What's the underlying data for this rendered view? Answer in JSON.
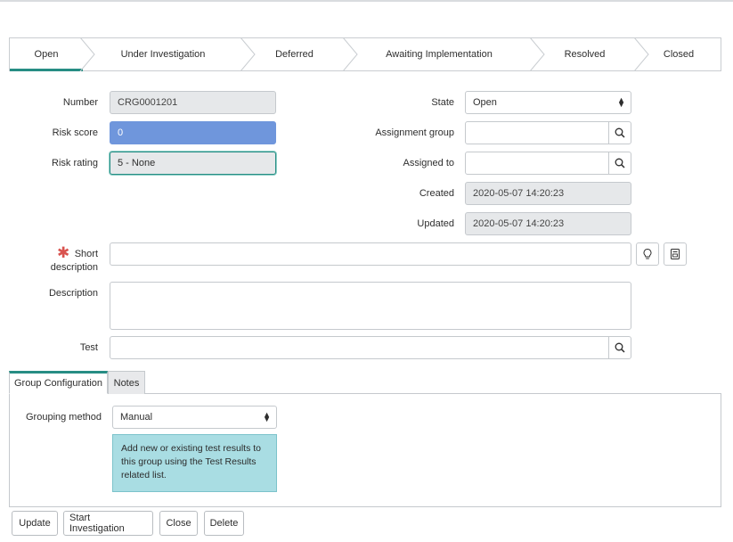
{
  "process_flow": {
    "steps": [
      {
        "label": "Open",
        "active": true
      },
      {
        "label": "Under Investigation",
        "active": false
      },
      {
        "label": "Deferred",
        "active": false
      },
      {
        "label": "Awaiting Implementation",
        "active": false
      },
      {
        "label": "Resolved",
        "active": false
      },
      {
        "label": "Closed",
        "active": false
      }
    ]
  },
  "form": {
    "number": {
      "label": "Number",
      "value": "CRG0001201"
    },
    "risk_score": {
      "label": "Risk score",
      "value": "0"
    },
    "risk_rating": {
      "label": "Risk rating",
      "value": "5 - None"
    },
    "state": {
      "label": "State",
      "value": "Open"
    },
    "assignment_group": {
      "label": "Assignment group",
      "value": ""
    },
    "assigned_to": {
      "label": "Assigned to",
      "value": ""
    },
    "created": {
      "label": "Created",
      "value": "2020-05-07 14:20:23"
    },
    "updated": {
      "label": "Updated",
      "value": "2020-05-07 14:20:23"
    },
    "short_description": {
      "label_line1": "Short",
      "label_line2": "description",
      "value": ""
    },
    "description": {
      "label": "Description",
      "value": ""
    },
    "test": {
      "label": "Test",
      "value": ""
    }
  },
  "tabs": [
    {
      "label": "Group Configuration",
      "active": true
    },
    {
      "label": "Notes",
      "active": false
    }
  ],
  "group_config": {
    "grouping_method": {
      "label": "Grouping method",
      "value": "Manual"
    },
    "info_text": "Add new or existing test results to this group using the Test Results related list."
  },
  "actions": {
    "update": "Update",
    "start_investigation": "Start Investigation",
    "close": "Close",
    "delete": "Delete"
  },
  "colors": {
    "accent": "#278d84",
    "risk_score_fill": "#6f96dc",
    "info_bg": "#a9dde3",
    "required": "#d9534f"
  }
}
